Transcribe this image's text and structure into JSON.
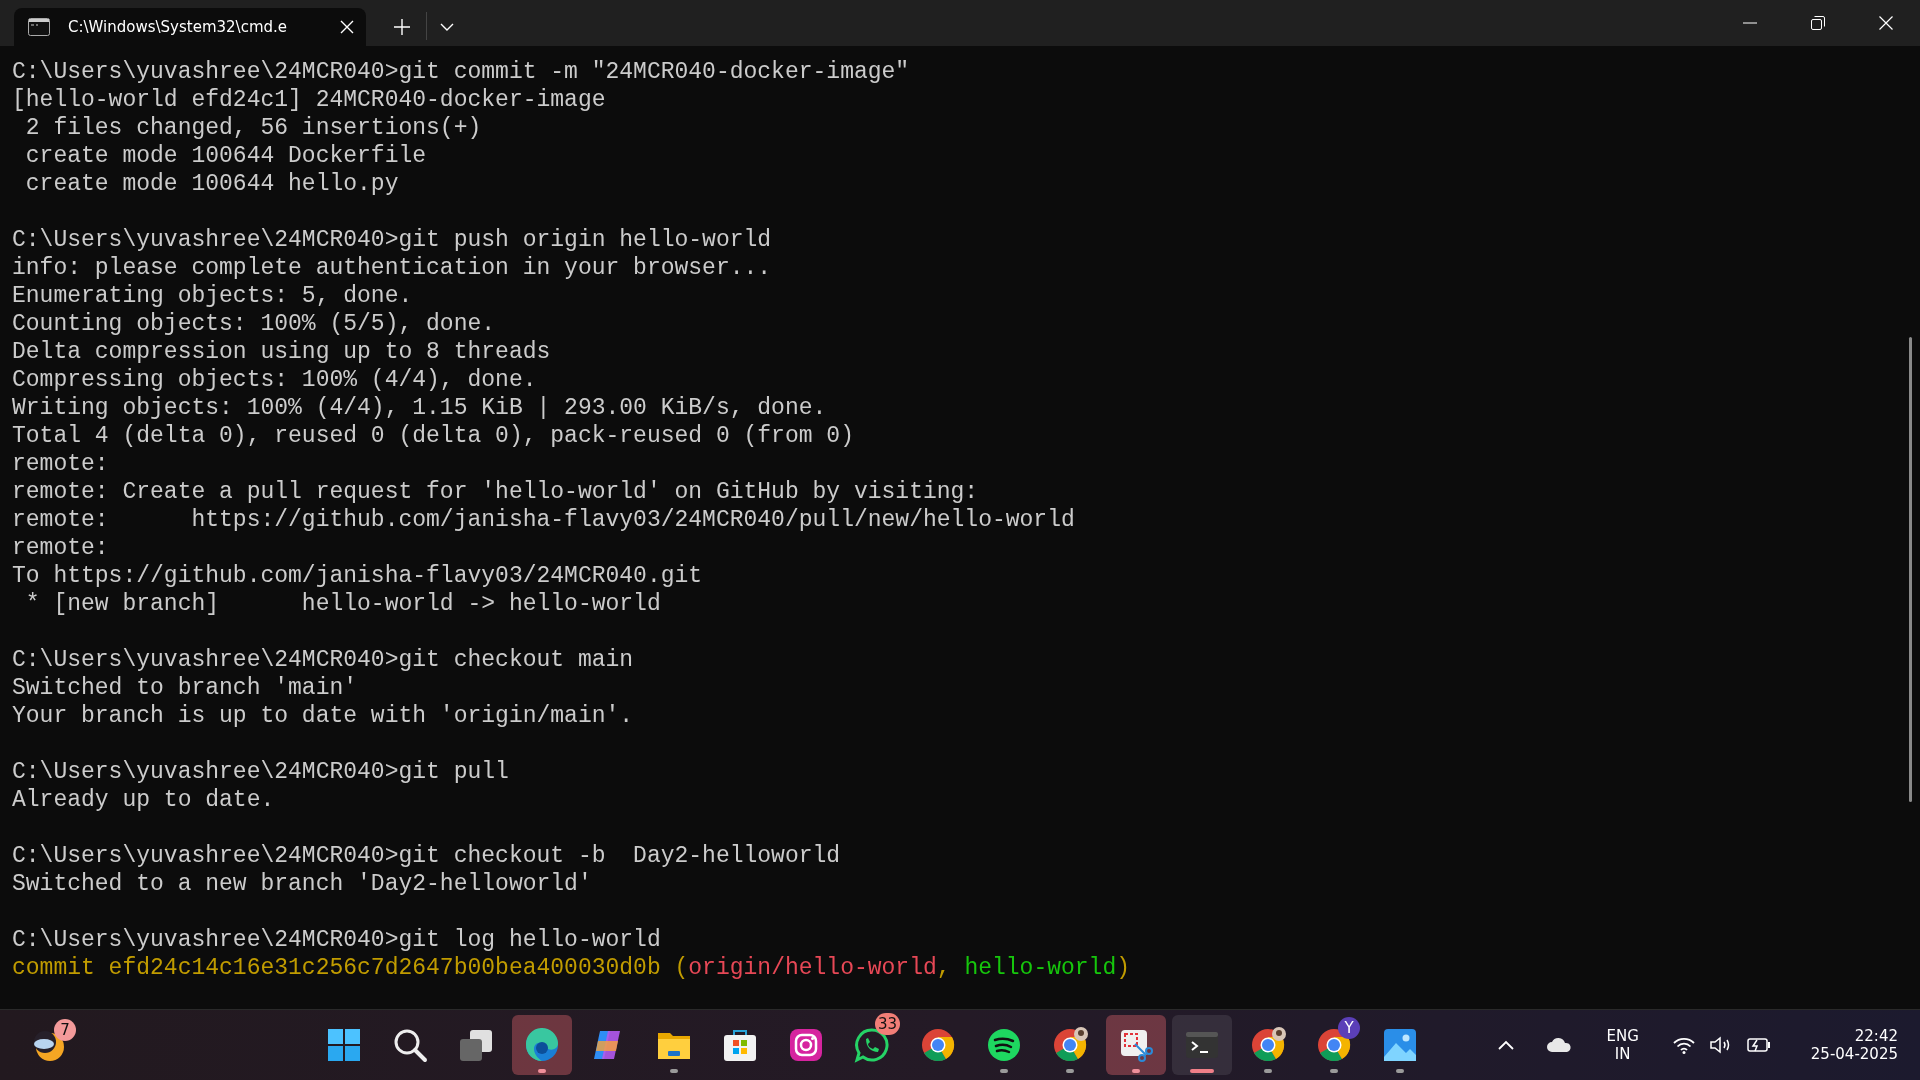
{
  "window": {
    "tab": {
      "title": "C:\\Windows\\System32\\cmd.e",
      "selected": true
    }
  },
  "terminal": {
    "blocks": [
      {
        "lines": [
          {
            "text": "C:\\Users\\yuvashree\\24MCR040>git commit -m \"24MCR040-docker-image\""
          },
          {
            "text": "[hello-world efd24c1] 24MCR040-docker-image"
          },
          {
            "text": " 2 files changed, 56 insertions(+)"
          },
          {
            "text": " create mode 100644 Dockerfile"
          },
          {
            "text": " create mode 100644 hello.py"
          }
        ]
      },
      {
        "lines": [
          {
            "text": "C:\\Users\\yuvashree\\24MCR040>git push origin hello-world"
          },
          {
            "text": "info: please complete authentication in your browser..."
          },
          {
            "text": "Enumerating objects: 5, done."
          },
          {
            "text": "Counting objects: 100% (5/5), done."
          },
          {
            "text": "Delta compression using up to 8 threads"
          },
          {
            "text": "Compressing objects: 100% (4/4), done."
          },
          {
            "text": "Writing objects: 100% (4/4), 1.15 KiB | 293.00 KiB/s, done."
          },
          {
            "text": "Total 4 (delta 0), reused 0 (delta 0), pack-reused 0 (from 0)"
          },
          {
            "text": "remote:"
          },
          {
            "text": "remote: Create a pull request for 'hello-world' on GitHub by visiting:"
          },
          {
            "text": "remote:      https://github.com/janisha-flavy03/24MCR040/pull/new/hello-world"
          },
          {
            "text": "remote:"
          },
          {
            "text": "To https://github.com/janisha-flavy03/24MCR040.git"
          },
          {
            "text": " * [new branch]      hello-world -> hello-world"
          }
        ]
      },
      {
        "lines": [
          {
            "text": "C:\\Users\\yuvashree\\24MCR040>git checkout main"
          },
          {
            "text": "Switched to branch 'main'"
          },
          {
            "text": "Your branch is up to date with 'origin/main'."
          }
        ]
      },
      {
        "lines": [
          {
            "text": "C:\\Users\\yuvashree\\24MCR040>git pull"
          },
          {
            "text": "Already up to date."
          }
        ]
      },
      {
        "lines": [
          {
            "text": "C:\\Users\\yuvashree\\24MCR040>git checkout -b  Day2-helloworld"
          },
          {
            "text": "Switched to a new branch 'Day2-helloworld'"
          }
        ]
      },
      {
        "lines": [
          {
            "text": "C:\\Users\\yuvashree\\24MCR040>git log hello-world"
          },
          {
            "segments": [
              {
                "text": "commit efd24c14c16e31c256c7d2647b00bea400030d0b (",
                "kind": "commit"
              },
              {
                "text": "origin/hello-world",
                "kind": "remote"
              },
              {
                "text": ", ",
                "kind": "commit"
              },
              {
                "text": "hello-world",
                "kind": "local"
              },
              {
                "text": ")",
                "kind": "commit"
              }
            ]
          }
        ]
      }
    ]
  },
  "taskbar": {
    "widget": {
      "badge": "7"
    },
    "apps": [
      {
        "kind": "start",
        "running": false,
        "selected": false,
        "flashing": false
      },
      {
        "kind": "search",
        "running": false,
        "selected": false,
        "flashing": false
      },
      {
        "kind": "taskview",
        "running": false,
        "selected": false,
        "flashing": false
      },
      {
        "kind": "edge",
        "running": true,
        "selected": false,
        "flashing": true
      },
      {
        "kind": "copilot",
        "running": false,
        "selected": false,
        "flashing": false
      },
      {
        "kind": "explorer",
        "running": true,
        "selected": false,
        "flashing": false
      },
      {
        "kind": "store",
        "running": false,
        "selected": false,
        "flashing": false
      },
      {
        "kind": "instagram",
        "running": false,
        "selected": false,
        "flashing": false
      },
      {
        "kind": "whatsapp",
        "running": false,
        "selected": false,
        "flashing": false,
        "badge": "33"
      },
      {
        "kind": "chrome",
        "running": false,
        "selected": false,
        "flashing": false
      },
      {
        "kind": "spotify",
        "running": true,
        "selected": false,
        "flashing": false
      },
      {
        "kind": "chrome-avatar",
        "running": true,
        "selected": false,
        "flashing": false
      },
      {
        "kind": "snip",
        "running": true,
        "selected": false,
        "flashing": true
      },
      {
        "kind": "terminal",
        "running": true,
        "selected": true,
        "flashing": false
      },
      {
        "kind": "chrome-avatar",
        "running": true,
        "selected": false,
        "flashing": false
      },
      {
        "kind": "chrome",
        "running": true,
        "selected": false,
        "flashing": false,
        "badge": "Y"
      },
      {
        "kind": "photos",
        "running": true,
        "selected": false,
        "flashing": false
      }
    ],
    "tray": {
      "language": "ENG",
      "region": "IN",
      "time": "22:42",
      "date": "25-04-2025"
    }
  }
}
